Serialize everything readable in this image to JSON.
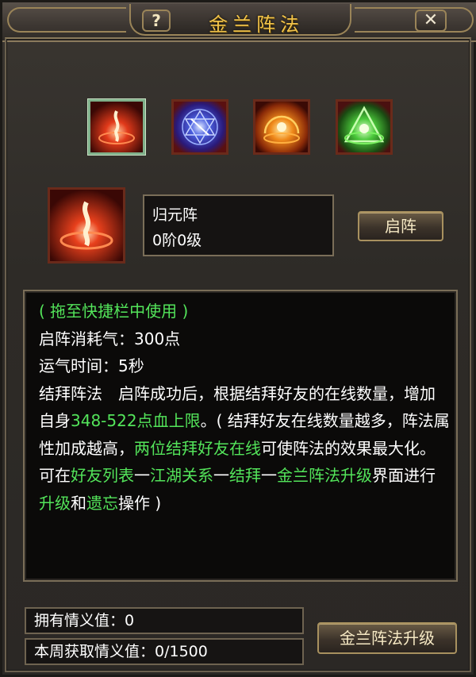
{
  "window": {
    "title": "金兰阵法",
    "help_label": "?",
    "close_label": "✕"
  },
  "formations": [
    {
      "name": "guiyuan",
      "icon": "red-flame-formation-icon",
      "selected": true
    },
    {
      "name": "blue",
      "icon": "blue-star-formation-icon",
      "selected": false
    },
    {
      "name": "orange",
      "icon": "orange-flame-formation-icon",
      "selected": false
    },
    {
      "name": "green",
      "icon": "green-triangle-formation-icon",
      "selected": false
    }
  ],
  "current": {
    "name": "归元阵",
    "level": "0阶0级",
    "activate_label": "启阵"
  },
  "description": {
    "hint": "( 拖至快捷栏中使用 )",
    "cost": "启阵消耗气：300点",
    "time": "运气时间：5秒",
    "p1": "结拜阵法　启阵成功后，根据结拜好友的在线数量，增加自身",
    "p2": "348-522点血上限",
    "p3": "。( 结拜好友在线数量越多，阵法属性加成越高，",
    "p4": "两位结拜好友在线",
    "p5": "可使阵法的效果最大化。可在",
    "p6": "好友列表",
    "p7": "一",
    "p8": "江湖关系",
    "p9": "一",
    "p10": "结拜",
    "p11": "一",
    "p12": "金兰阵法升级",
    "p13": "界面进行",
    "p14": "升级",
    "p15": "和",
    "p16": "遗忘",
    "p17": "操作 )"
  },
  "stats": {
    "friendship": "拥有情义值：0",
    "weekly": "本周获取情义值：0/1500"
  },
  "upgrade_label": "金兰阵法升级",
  "colors": {
    "title_gold": "#f1c34a",
    "highlight_green": "#53e45a",
    "frame_brown": "#9a8458"
  }
}
